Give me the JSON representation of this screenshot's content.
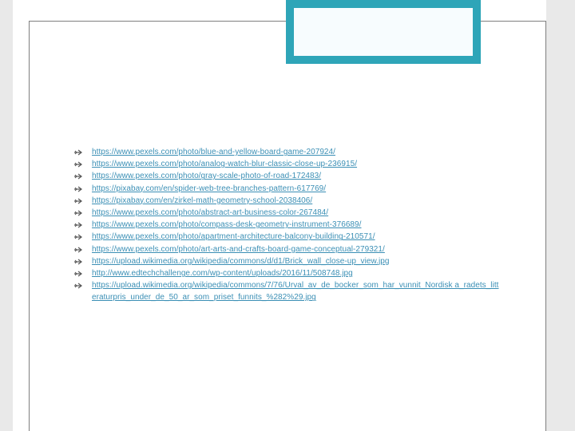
{
  "colors": {
    "link": "#3b8fb5",
    "frame_border": "#7f7f7f",
    "accent_teal": "#2ea5b8",
    "side_panel": "#e9e9e9",
    "bullet": "#595959"
  },
  "links": {
    "bullet_icon": "arrow-bullet",
    "items": [
      {
        "url": "https://www.pexels.com/photo/blue-and-yellow-board-game-207924/"
      },
      {
        "url": "https://www.pexels.com/photo/analog-watch-blur-classic-close-up-236915/"
      },
      {
        "url": "https://www.pexels.com/photo/gray-scale-photo-of-road-172483/"
      },
      {
        "url": "https://pixabay.com/en/spider-web-tree-branches-pattern-617769/"
      },
      {
        "url": "https://pixabay.com/en/zirkel-math-geometry-school-2038406/"
      },
      {
        "url": "https://www.pexels.com/photo/abstract-art-business-color-267484/"
      },
      {
        "url": "https://www.pexels.com/photo/compass-desk-geometry-instrument-376689/"
      },
      {
        "url": "https://www.pexels.com/photo/apartment-architecture-balcony-building-210571/"
      },
      {
        "url": "https://www.pexels.com/photo/art-arts-and-crafts-board-game-conceptual-279321/"
      },
      {
        "url": "https://upload.wikimedia.org/wikipedia/commons/d/d1/Brick_wall_close-up_view.jpg"
      },
      {
        "url": "http://www.edtechchallenge.com/wp-content/uploads/2016/11/508748.jpg"
      },
      {
        "url": "https://upload.wikimedia.org/wikipedia/commons/7/76/Urval_av_de_bocker_som_har_vunnit_Nordisk a_radets_litteraturpris_under_de_50_ar_som_priset_funnits_%282%29.jpg"
      }
    ]
  }
}
